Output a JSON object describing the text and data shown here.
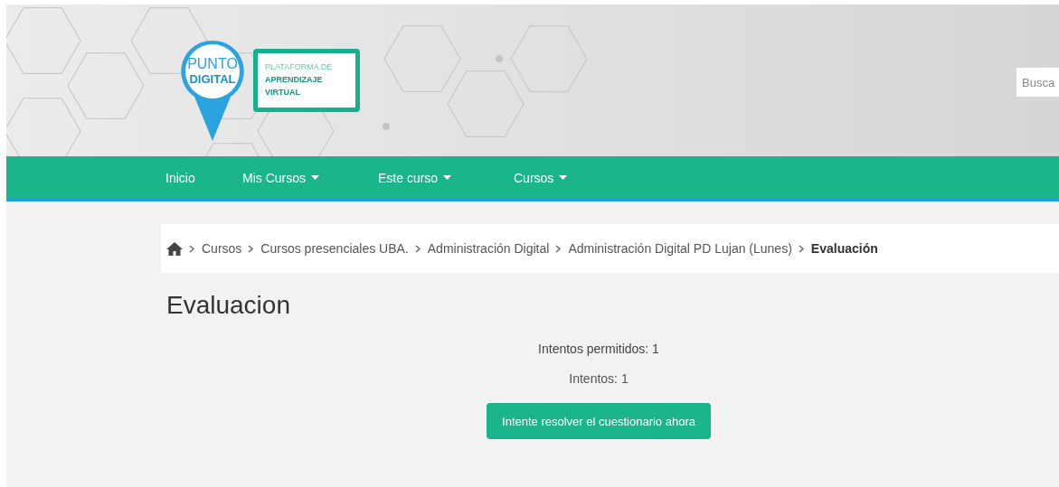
{
  "header": {
    "logo": {
      "pin_lines": [
        "PUNTO",
        "DIGITAL"
      ],
      "board_lines": [
        "PLATAFORMA DE",
        "APRENDIZAJE",
        "VIRTUAL"
      ]
    },
    "search": {
      "placeholder": "Busca"
    }
  },
  "nav": [
    {
      "label": "Inicio",
      "dropdown": false
    },
    {
      "label": "Mis Cursos",
      "dropdown": true
    },
    {
      "label": "Este curso",
      "dropdown": true
    },
    {
      "label": "Cursos",
      "dropdown": true
    }
  ],
  "breadcrumb": [
    {
      "label": "Cursos",
      "current": false
    },
    {
      "label": "Cursos presenciales UBA.",
      "current": false
    },
    {
      "label": "Administración Digital",
      "current": false
    },
    {
      "label": "Administración Digital PD Lujan (Lunes)",
      "current": false
    },
    {
      "label": "Evaluación",
      "current": true
    }
  ],
  "page_title": "Evaluacion",
  "info": [
    "Intentos permitidos: 1",
    "Intentos: 1"
  ],
  "action_button": "Intente resolver el cuestionario ahora"
}
